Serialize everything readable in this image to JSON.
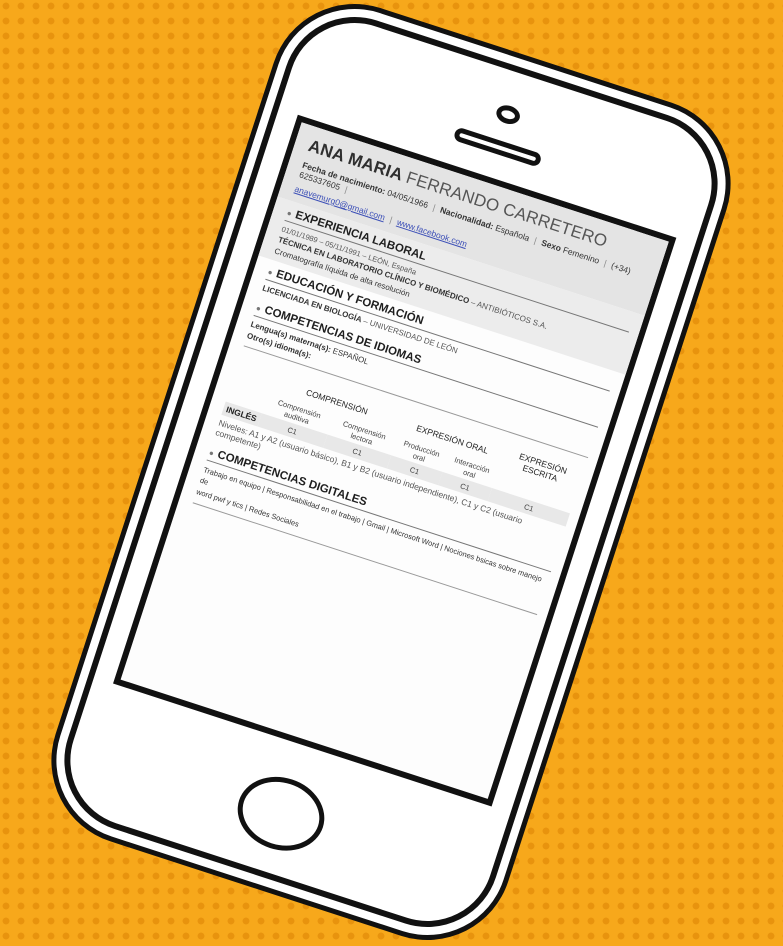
{
  "cv": {
    "first_name": "ANA MARIA",
    "last_name": "FERRANDO CARRETERO",
    "birth_label": "Fecha de nacimiento:",
    "birth_value": "04/05/1966",
    "nationality_label": "Nacionalidad:",
    "nationality_value": "Española",
    "sex_label": "Sexo",
    "sex_value": "Femenino",
    "phone": "(+34) 625337605",
    "email": "anavemurg0@gmail.com",
    "website": "www.facebook.com",
    "sections": {
      "experience": {
        "title": "EXPERIENCIA LABORAL",
        "dates": "01/01/1989 – 05/11/1991 – LEÓN, España",
        "job_title": "TÉCNICA EN LABORATORIO CLÍNICO Y BIOMÉDICO",
        "company": "– ANTIBIÓTICOS S.A.",
        "description": "Cromatografía líquida de alta resolución"
      },
      "education": {
        "title": "EDUCACIÓN Y FORMACIÓN",
        "degree": "LICENCIADA EN BIOLOGÍA",
        "school": "– UNIVERSIDAD DE LEÓN"
      },
      "languages": {
        "title": "COMPETENCIAS DE IDIOMAS",
        "mother_label": "Lengua(s) materna(s):",
        "mother_value": "ESPAÑOL",
        "other_label": "Otro(s) idioma(s):",
        "group_comprehension": "COMPRENSIÓN",
        "group_oral": "EXPRESIÓN ORAL",
        "group_written": "EXPRESIÓN ESCRITA",
        "col_listening": "Comprensión auditiva",
        "col_reading": "Comprensión lectora",
        "col_production": "Producción oral",
        "col_interaction": "Interacción oral",
        "language": "INGLÉS",
        "levels": [
          "C1",
          "C1",
          "C1",
          "C1",
          "C1"
        ],
        "levels_note": "Niveles: A1 y A2 (usuario básico), B1 y B2 (usuario independiente), C1 y C2 (usuario competente)"
      },
      "digital": {
        "title": "COMPETENCIAS DIGITALES",
        "skills_line1": "Trabajo en equipo | Responsabilidad en el trabajo | Gmail | Microsoft Word | Nociones bsicas sobre manejo de",
        "skills_line2": "word pwf y tics | Redes Sociales"
      }
    }
  }
}
